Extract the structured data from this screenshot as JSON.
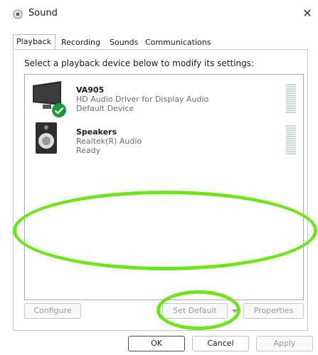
{
  "window": {
    "title": "Sound",
    "close_glyph": "✕",
    "app_icon": "speaker-icon"
  },
  "tabs": [
    {
      "label": "Playback",
      "active": true
    },
    {
      "label": "Recording",
      "active": false
    },
    {
      "label": "Sounds",
      "active": false
    },
    {
      "label": "Communications",
      "active": false
    }
  ],
  "instruction": "Select a playback device below to modify its settings:",
  "devices": [
    {
      "name": "VA905",
      "driver": "HD Audio Driver for Display Audio",
      "status": "Default Device",
      "icon": "monitor-icon",
      "badge": "default-check-icon"
    },
    {
      "name": "Speakers",
      "driver": "Realtek(R) Audio",
      "status": "Ready",
      "icon": "speaker-device-icon"
    }
  ],
  "buttons": {
    "configure": {
      "label": "Configure",
      "enabled": false
    },
    "set_default": {
      "label": "Set Default",
      "enabled": false
    },
    "properties": {
      "label": "Properties",
      "enabled": false
    },
    "ok": {
      "label": "OK",
      "enabled": true
    },
    "cancel": {
      "label": "Cancel",
      "enabled": true
    },
    "apply": {
      "label": "Apply",
      "enabled": false
    }
  },
  "colors": {
    "annotation": "#6ee51a",
    "default_badge": "#1a9a3c",
    "level_meter": "#c9d8d1"
  }
}
